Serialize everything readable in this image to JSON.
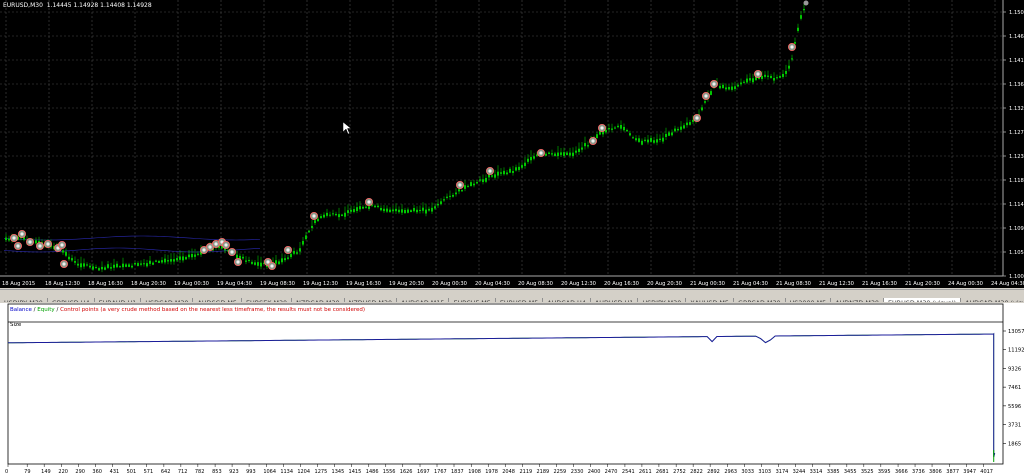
{
  "window": {
    "title": "EURUSD,M30",
    "ohlc": "1.14445 1.14928 1.14408 1.14928"
  },
  "colors": {
    "candle": "#00c800",
    "grid": "#4a4a4a",
    "axis_text": "#ffffff",
    "marker_fill": "#f0f0f0",
    "marker_ring": "#ff6666",
    "balance": "#1c1c9c",
    "equity": "#00a000",
    "control_points": "#d00000"
  },
  "price_axis": {
    "labels": [
      "1.1505",
      "1.1460",
      "1.1415",
      "1.1369",
      "1.1324",
      "1.1279",
      "1.1233",
      "1.1188",
      "1.1143",
      "1.1098",
      "1.1052",
      "1.1007"
    ]
  },
  "time_axis": {
    "labels": [
      "18 Aug 2015",
      "18 Aug 12:30",
      "18 Aug 16:30",
      "18 Aug 20:30",
      "19 Aug 00:30",
      "19 Aug 04:30",
      "19 Aug 08:30",
      "19 Aug 12:30",
      "19 Aug 16:30",
      "19 Aug 20:30",
      "20 Aug 00:30",
      "20 Aug 04:30",
      "20 Aug 08:30",
      "20 Aug 12:30",
      "20 Aug 16:30",
      "20 Aug 20:30",
      "21 Aug 00:30",
      "21 Aug 04:30",
      "21 Aug 08:30",
      "21 Aug 12:30",
      "21 Aug 16:30",
      "21 Aug 20:30",
      "24 Aug 00:30",
      "24 Aug 04:30"
    ]
  },
  "tabs": [
    {
      "label": "USDJPY,M30",
      "active": false
    },
    {
      "label": "GBPUSD,H4",
      "active": false
    },
    {
      "label": "EURAUD,H1",
      "active": false
    },
    {
      "label": "USDCAD,M30",
      "active": false
    },
    {
      "label": "AUDSGD,M5",
      "active": false
    },
    {
      "label": "EURSEK,M30",
      "active": false
    },
    {
      "label": "NZDCAD,M30",
      "active": false
    },
    {
      "label": "NZDUSD,M30",
      "active": false
    },
    {
      "label": "AUDCAD,M15",
      "active": false
    },
    {
      "label": "EURCHF,M5",
      "active": false
    },
    {
      "label": "EURUSD,M5",
      "active": false
    },
    {
      "label": "AUDCAD,H4",
      "active": false
    },
    {
      "label": "AUDUSD,H1",
      "active": false
    },
    {
      "label": "USDJPY,M30",
      "active": false
    },
    {
      "label": "XAUUSD,M5",
      "active": false
    },
    {
      "label": "GBPCAD,M30",
      "active": false
    },
    {
      "label": "US2000,M5",
      "active": false
    },
    {
      "label": "AUDNZD,M30",
      "active": false
    },
    {
      "label": "EURUSD,M30 (visual)",
      "active": true
    },
    {
      "label": "AUDCAD,M30 (visual)",
      "active": false
    }
  ],
  "tester": {
    "legend": {
      "balance": "Balance",
      "sep": " / ",
      "equity": "Equity",
      "sep2": " / ",
      "control_points": "Control points (a very crude method based on the nearest less timeframe, the results must not be considered)"
    },
    "size_label": "Size",
    "y_labels": [
      "13057",
      "11192",
      "9326",
      "7461",
      "5596",
      "3731",
      "1865"
    ],
    "x_labels": [
      "0",
      "79",
      "149",
      "220",
      "290",
      "360",
      "431",
      "501",
      "571",
      "642",
      "712",
      "782",
      "853",
      "923",
      "993",
      "1064",
      "1134",
      "1204",
      "1275",
      "1345",
      "1415",
      "1486",
      "1556",
      "1626",
      "1697",
      "1767",
      "1837",
      "1908",
      "1978",
      "2048",
      "2119",
      "2189",
      "2259",
      "2330",
      "2400",
      "2470",
      "2541",
      "2611",
      "2681",
      "2752",
      "2822",
      "2892",
      "2963",
      "3033",
      "3103",
      "3174",
      "3244",
      "3314",
      "3385",
      "3455",
      "3525",
      "3595",
      "3666",
      "3736",
      "3806",
      "3877",
      "3947",
      "4017"
    ]
  },
  "chart_data": {
    "type": "line",
    "title": "",
    "series": [
      {
        "name": "Balance",
        "y_start": 11880,
        "y_end": 12760
      },
      {
        "name": "Equity",
        "y_start": 11880,
        "y_end": 12760
      }
    ],
    "ylim": [
      0,
      13057
    ],
    "xlim": [
      0,
      4090
    ]
  }
}
